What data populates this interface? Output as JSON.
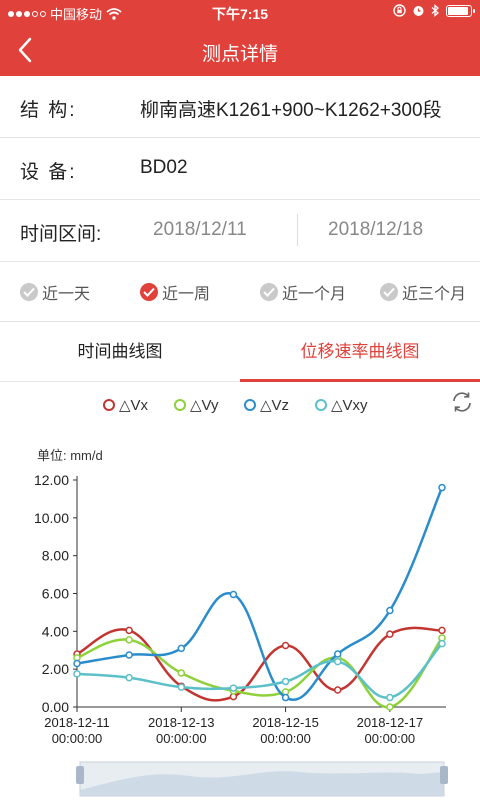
{
  "status_bar": {
    "carrier": "中国移动",
    "time": "下午7:15"
  },
  "nav": {
    "title": "测点详情",
    "back_icon": "chevron-left-icon"
  },
  "info": {
    "structure_label": "结    构:",
    "structure_value": "柳南高速K1261+900~K1262+300段",
    "device_label": "设    备:",
    "device_value": "BD02",
    "range_label": "时间区间:",
    "start_date": "2018/12/11",
    "end_date": "2018/12/18"
  },
  "periods": [
    {
      "label": "近一天",
      "selected": false
    },
    {
      "label": "近一周",
      "selected": true
    },
    {
      "label": "近一个月",
      "selected": false
    },
    {
      "label": "近三个月",
      "selected": false
    }
  ],
  "tabs": {
    "time_curve": "时间曲线图",
    "rate_curve": "位移速率曲线图",
    "active": "rate_curve"
  },
  "accent_color": "#e0413a",
  "chart_data": {
    "type": "line",
    "unit_label": "单位:  mm/d",
    "x_ticks": [
      "2018-12-11\n00:00:00",
      "2018-12-13\n00:00:00",
      "2018-12-15\n00:00:00",
      "2018-12-17\n00:00:00"
    ],
    "x": [
      "2018-12-11",
      "2018-12-12",
      "2018-12-13",
      "2018-12-14",
      "2018-12-15",
      "2018-12-16",
      "2018-12-17",
      "2018-12-18"
    ],
    "y_ticks": [
      "0.00",
      "2.00",
      "4.00",
      "6.00",
      "8.00",
      "10.00",
      "12.00"
    ],
    "ylim": [
      0,
      12
    ],
    "series": [
      {
        "name": "△Vx",
        "color": "#c23531",
        "values": [
          2.8,
          4.05,
          1.1,
          0.55,
          3.25,
          0.9,
          3.85,
          4.05
        ]
      },
      {
        "name": "△Vy",
        "color": "#8fd13a",
        "values": [
          2.6,
          3.55,
          1.8,
          0.85,
          0.8,
          2.6,
          0.0,
          3.65
        ]
      },
      {
        "name": "△Vz",
        "color": "#2b8ccc",
        "values": [
          2.3,
          2.75,
          3.1,
          5.95,
          0.5,
          2.8,
          5.1,
          11.6
        ]
      },
      {
        "name": "△Vxy",
        "color": "#5bc0c8",
        "values": [
          1.75,
          1.55,
          1.05,
          1.0,
          1.35,
          2.4,
          0.5,
          3.35
        ]
      }
    ],
    "grid": false,
    "legend_position": "top"
  }
}
